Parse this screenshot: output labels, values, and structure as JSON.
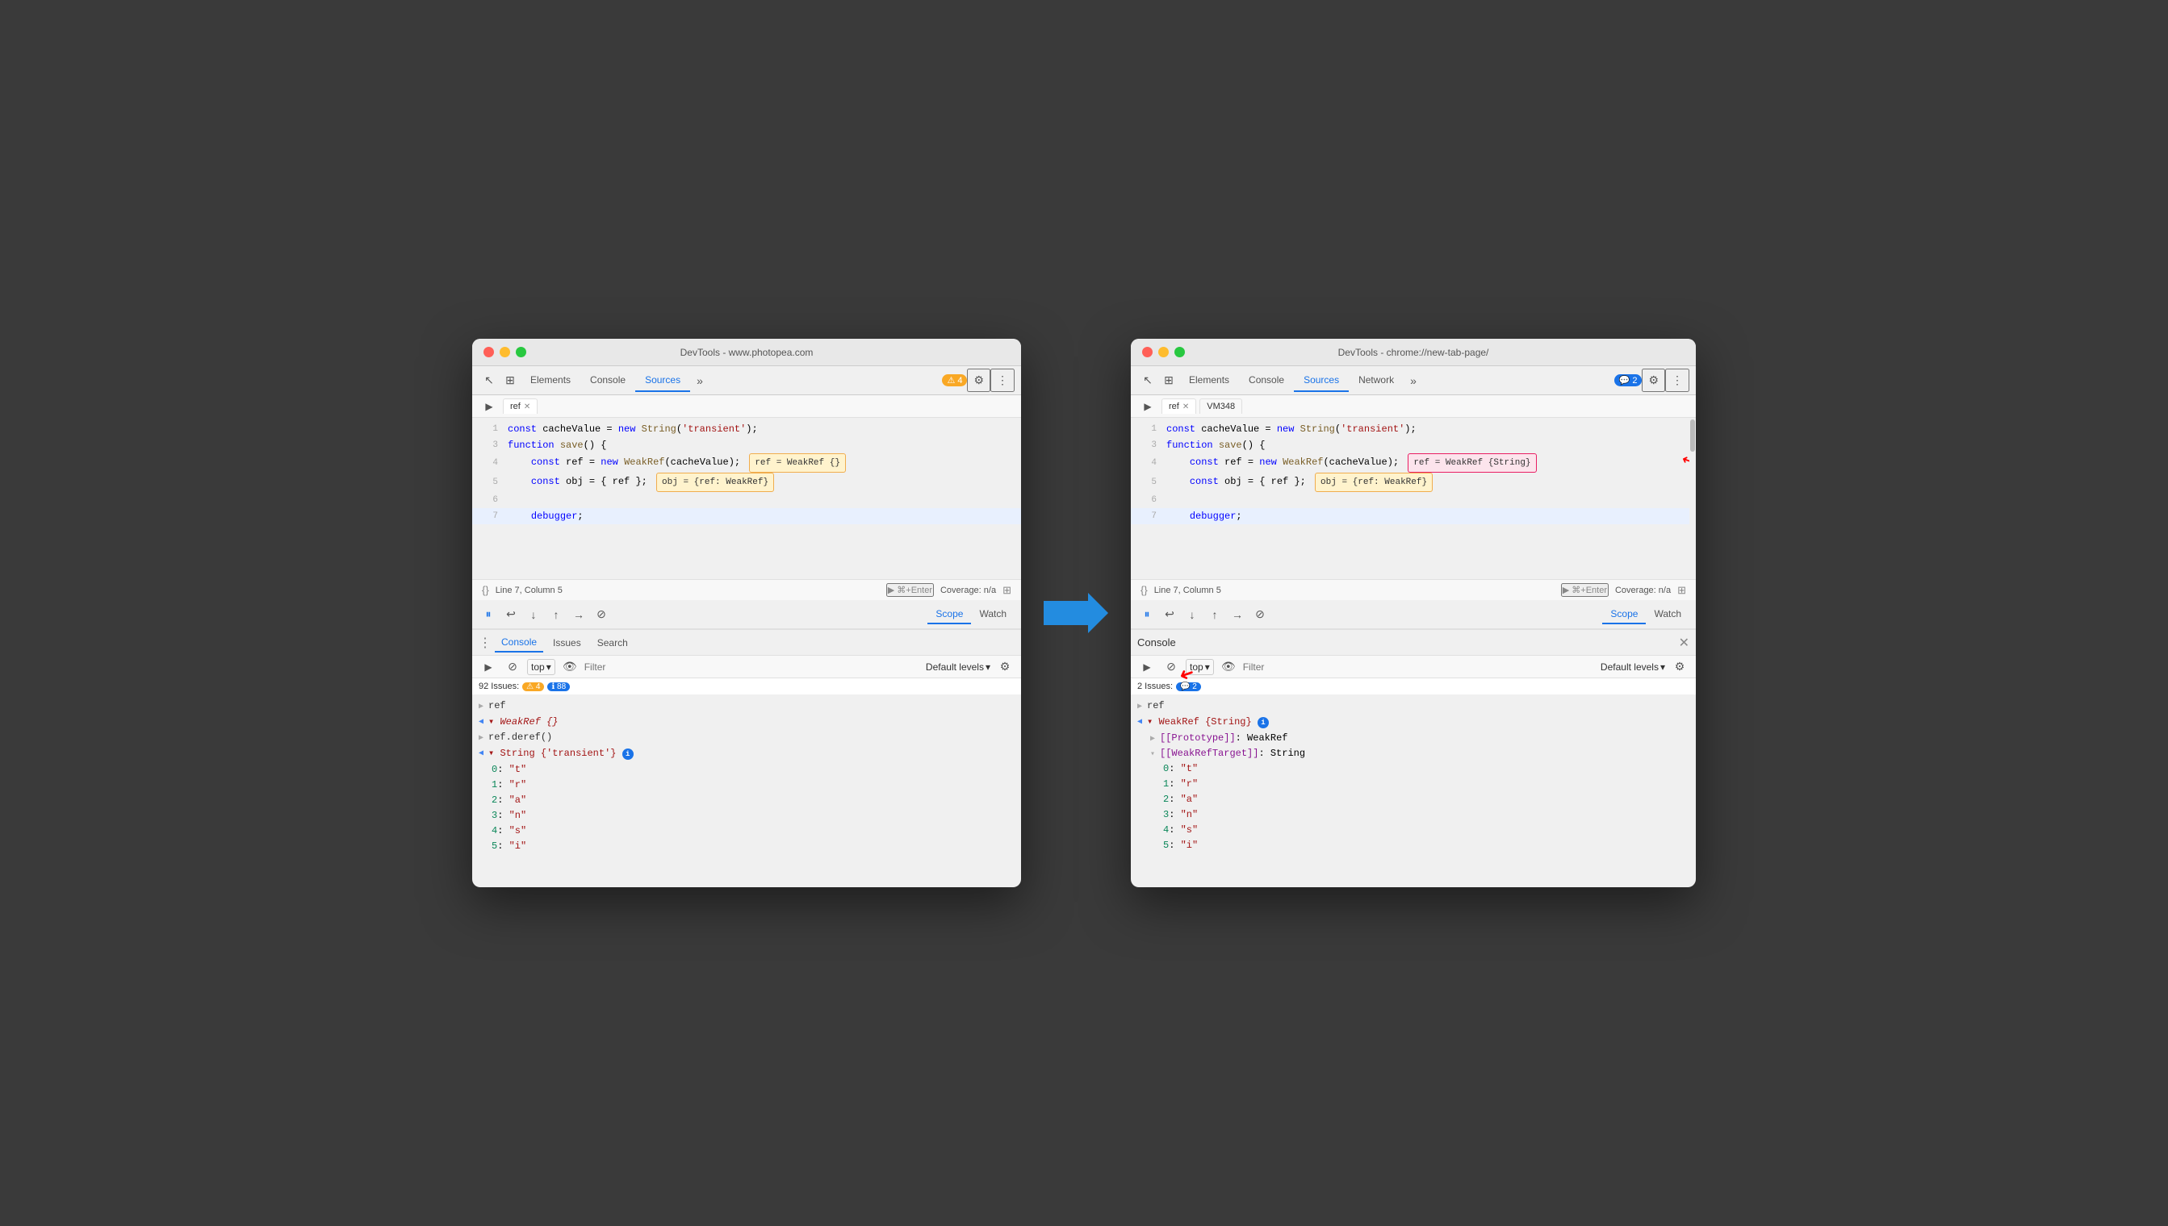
{
  "left_window": {
    "title": "DevTools - www.photopea.com",
    "controls": [
      "close",
      "minimize",
      "maximize"
    ],
    "tabs": [
      "Elements",
      "Console",
      "Sources",
      "»"
    ],
    "active_tab": "Sources",
    "badge": {
      "type": "warning",
      "count": "4"
    },
    "file_tabs": [
      {
        "name": "ref",
        "active": true
      }
    ],
    "code_lines": [
      {
        "num": "1",
        "content": "const cacheValue = new String('transient');",
        "highlight": false
      },
      {
        "num": "3",
        "content": "function save() {",
        "highlight": false
      },
      {
        "num": "4",
        "content": "    const ref = new WeakRef(cacheValue);  ref = WeakRef {}",
        "highlight": false
      },
      {
        "num": "5",
        "content": "    const obj = { ref };  obj = {ref: WeakRef}",
        "highlight": false
      },
      {
        "num": "6",
        "content": "",
        "highlight": false
      },
      {
        "num": "7",
        "content": "    debugger;",
        "highlight": true
      }
    ],
    "status_bar": {
      "location": "Line 7, Column 5",
      "coverage": "Coverage: n/a"
    },
    "debug_tabs": [
      "Scope",
      "Watch"
    ],
    "active_debug_tab": "Scope",
    "bottom_tabs": [
      "Console",
      "Issues",
      "Search"
    ],
    "active_bottom_tab": "Console",
    "console_toolbar": {
      "filter_placeholder": "Filter",
      "level": "Default levels"
    },
    "issues_count": "92 Issues:",
    "issues_warn": "4",
    "issues_info": "88",
    "console_entries": [
      {
        "type": "collapsed",
        "content": "ref"
      },
      {
        "type": "expanded_left",
        "content": "WeakRef {}"
      },
      {
        "type": "collapsed",
        "content": "ref.deref()"
      },
      {
        "type": "expanded_left",
        "content": "String {'transient'}"
      },
      {
        "indent": 1,
        "content": "0: \"t\""
      },
      {
        "indent": 1,
        "content": "1: \"r\""
      },
      {
        "indent": 1,
        "content": "2: \"a\""
      },
      {
        "indent": 1,
        "content": "3: \"n\""
      },
      {
        "indent": 1,
        "content": "4: \"s\""
      },
      {
        "indent": 1,
        "content": "5: \"i\""
      }
    ],
    "top_label": "top"
  },
  "right_window": {
    "title": "DevTools - chrome://new-tab-page/",
    "controls": [
      "close",
      "minimize",
      "maximize"
    ],
    "tabs": [
      "Elements",
      "Console",
      "Sources",
      "Network",
      "»"
    ],
    "active_tab": "Sources",
    "badge": {
      "type": "info",
      "count": "2"
    },
    "file_tabs": [
      {
        "name": "ref",
        "active": true
      },
      {
        "name": "VM348",
        "active": false
      }
    ],
    "code_lines": [
      {
        "num": "1",
        "content": "const cacheValue = new String('transient');",
        "highlight": false
      },
      {
        "num": "3",
        "content": "function save() {",
        "highlight": false
      },
      {
        "num": "4",
        "content": "    const ref = new WeakRef(cacheValue);  ref = WeakRef {String}",
        "highlight": false
      },
      {
        "num": "5",
        "content": "    const obj = { ref };  obj = {ref: WeakRef}",
        "highlight": false
      },
      {
        "num": "6",
        "content": "",
        "highlight": false
      },
      {
        "num": "7",
        "content": "    debugger;",
        "highlight": true
      }
    ],
    "status_bar": {
      "location": "Line 7, Column 5",
      "coverage": "Coverage: n/a"
    },
    "debug_tabs": [
      "Scope",
      "Watch"
    ],
    "active_debug_tab": "Scope",
    "console_title": "Console",
    "console_toolbar": {
      "filter_placeholder": "Filter",
      "level": "Default levels"
    },
    "issues_count": "2 Issues:",
    "issues_info": "2",
    "console_entries": [
      {
        "type": "collapsed",
        "content": "ref",
        "arrow": true
      },
      {
        "type": "expanded_left",
        "content": "WeakRef {String}",
        "info": true
      },
      {
        "indent": 1,
        "content": "[[Prototype]]: WeakRef"
      },
      {
        "indent": 1,
        "content": "[[WeakRefTarget]]: String",
        "expanded": true
      },
      {
        "indent": 2,
        "content": "0: \"t\""
      },
      {
        "indent": 2,
        "content": "1: \"r\""
      },
      {
        "indent": 2,
        "content": "2: \"a\""
      },
      {
        "indent": 2,
        "content": "3: \"n\""
      },
      {
        "indent": 2,
        "content": "4: \"s\""
      },
      {
        "indent": 2,
        "content": "5: \"i\""
      }
    ],
    "top_label": "top"
  },
  "icons": {
    "play": "▶",
    "pause": "⏸",
    "step_over": "⤼",
    "step_into": "↓",
    "step_out": "↑",
    "step": "→",
    "deactivate": "⊘",
    "close": "✕",
    "gear": "⚙",
    "dots": "⋮",
    "chevron_right": "▶",
    "triangle_down": "▾",
    "circle_arrow": "↩",
    "eye": "👁",
    "cursor": "↖",
    "layers": "⊞",
    "more": "»",
    "warning": "⚠",
    "info": "ℹ",
    "ban": "⊘",
    "filter": "⊘",
    "coverage": "Coverage: n/a"
  }
}
